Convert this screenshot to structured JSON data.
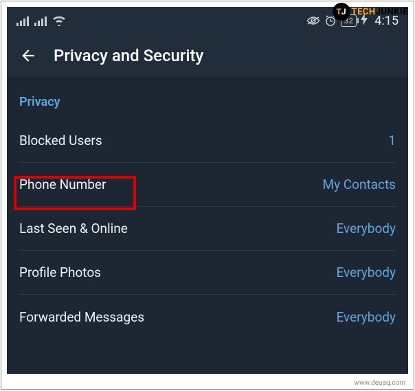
{
  "status_bar": {
    "battery_percentage": "32",
    "time": "4:15"
  },
  "header": {
    "title": "Privacy and Security"
  },
  "section": {
    "title": "Privacy"
  },
  "rows": {
    "blocked": {
      "label": "Blocked Users",
      "value": "1"
    },
    "phone": {
      "label": "Phone Number",
      "value": "My Contacts"
    },
    "lastseen": {
      "label": "Last Seen & Online",
      "value": "Everybody"
    },
    "photos": {
      "label": "Profile Photos",
      "value": "Everybody"
    },
    "forwarded": {
      "label": "Forwarded Messages",
      "value": "Everybody"
    }
  },
  "watermark": {
    "logo_t": "T",
    "logo_j": "J",
    "text_tech": "TECH",
    "text_junkie": "JUNKIE",
    "source": "www.deuaq.com"
  }
}
